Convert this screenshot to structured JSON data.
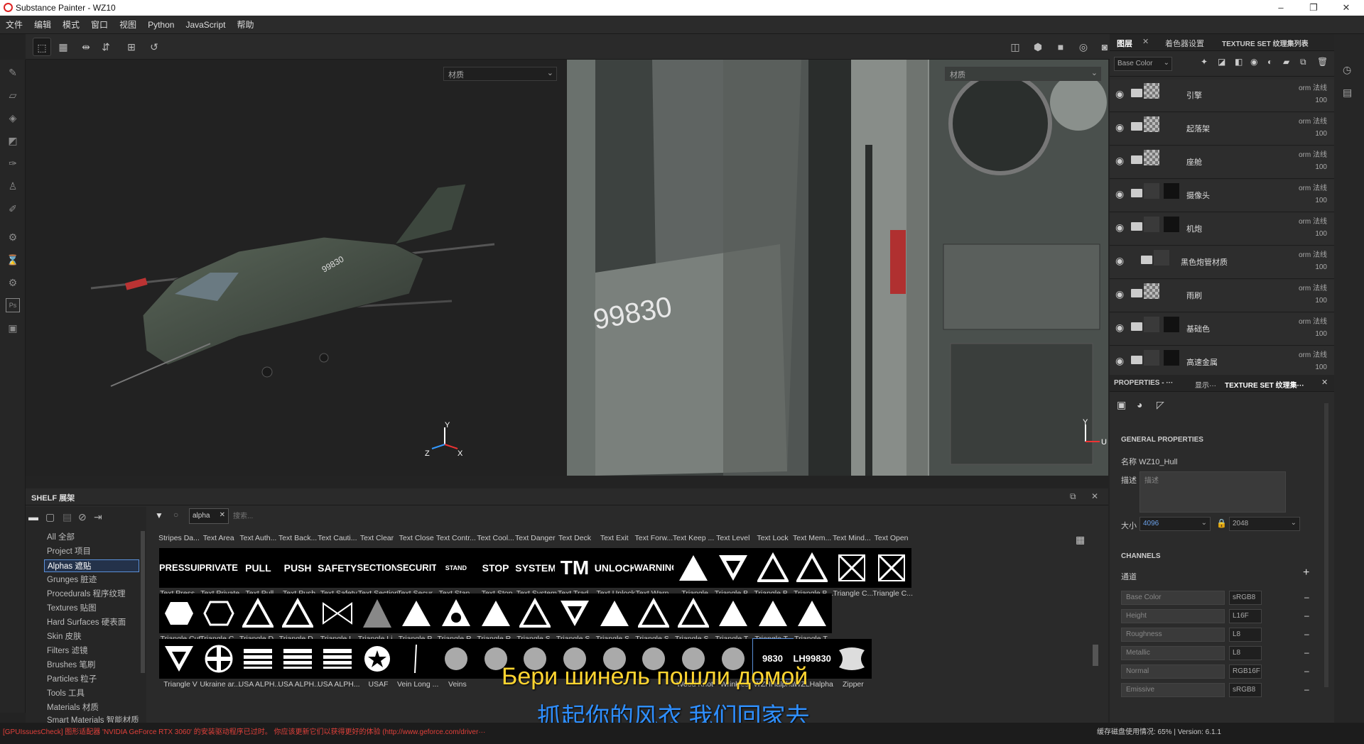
{
  "window": {
    "title": "Substance Painter - WZ10"
  },
  "menu": [
    "文件",
    "编辑",
    "模式",
    "窗口",
    "视图",
    "Python",
    "JavaScript",
    "帮助"
  ],
  "viewport": {
    "left_dropdown": "材质",
    "right_dropdown": "材质",
    "axes": {
      "x": "X",
      "y": "Y",
      "z": "Z",
      "u": "U"
    },
    "decal_text": "99830"
  },
  "layers_panel": {
    "tabs": [
      "图层",
      "着色器设置",
      "TEXTURE SET 纹理集列表"
    ],
    "channel_select": "Base Color",
    "layers": [
      {
        "name": "引擎",
        "blend": "orm 法线",
        "opacity": "100"
      },
      {
        "name": "起落架",
        "blend": "orm 法线",
        "opacity": "100"
      },
      {
        "name": "座舱",
        "blend": "orm 法线",
        "opacity": "100"
      },
      {
        "name": "摄像头",
        "blend": "orm 法线",
        "opacity": "100"
      },
      {
        "name": "机炮",
        "blend": "orm 法线",
        "opacity": "100"
      },
      {
        "name": "黑色炮管材质",
        "blend": "orm 法线",
        "opacity": "100"
      },
      {
        "name": "雨刷",
        "blend": "orm 法线",
        "opacity": "100"
      },
      {
        "name": "基础色",
        "blend": "orm 法线",
        "opacity": "100"
      },
      {
        "name": "高速金属",
        "blend": "orm 法线",
        "opacity": "100"
      }
    ]
  },
  "properties": {
    "tabs": [
      "PROPERTIES - ···",
      "显示···",
      "TEXTURE SET 纹理集···"
    ],
    "general_title": "GENERAL PROPERTIES",
    "name_label": "名称",
    "name_value": "WZ10_Hull",
    "desc_label": "描述",
    "desc_placeholder": "描述",
    "size_label": "大小",
    "size_value": "4096",
    "size_value2": "2048",
    "channels_title": "CHANNELS",
    "channels_label": "通道",
    "channels": [
      {
        "name": "Base Color",
        "format": "sRGB8"
      },
      {
        "name": "Height",
        "format": "L16F"
      },
      {
        "name": "Roughness",
        "format": "L8"
      },
      {
        "name": "Metallic",
        "format": "L8"
      },
      {
        "name": "Normal",
        "format": "RGB16F"
      },
      {
        "name": "Emissive",
        "format": "sRGB8"
      }
    ]
  },
  "shelf": {
    "title": "SHELF 展架",
    "categories": [
      "All 全部",
      "Project 项目",
      "Alphas 遮贴",
      "Grunges 脏迹",
      "Procedurals 程序纹理",
      "Textures 贴图",
      "Hard Surfaces 硬表面",
      "Skin 皮肤",
      "Filters 滤镜",
      "Brushes 笔刷",
      "Particles 粒子",
      "Tools 工具",
      "Materials 材质",
      "Smart Materials 智能材质"
    ],
    "selected_category": "Alphas 遮贴",
    "filter_tag": "alpha",
    "search_placeholder": "搜索...",
    "row0_labels": [
      "Stripes Da...",
      "Text Area",
      "Text Auth...",
      "Text Back...",
      "Text Cauti...",
      "Text Clear",
      "Text Close",
      "Text Contr...",
      "Text Cool...",
      "Text Danger",
      "Text Deck",
      "Text Exit",
      "Text Forw...",
      "Text Keep ...",
      "Text Level",
      "Text Lock",
      "Text Mem...",
      "Text Mind...",
      "Text Open"
    ],
    "row1": [
      {
        "img": "PRESSURE",
        "label": "Text Press..."
      },
      {
        "img": "PRIVATE",
        "label": "Text Private"
      },
      {
        "img": "PULL",
        "label": "Text Pull"
      },
      {
        "img": "PUSH",
        "label": "Text Push"
      },
      {
        "img": "SAFETY",
        "label": "Text Safety"
      },
      {
        "img": "SECTION",
        "label": "Text Section"
      },
      {
        "img": "SECURITY",
        "label": "Text Secur..."
      },
      {
        "img": "STAND CLEAR",
        "label": "Text Stan..."
      },
      {
        "img": "STOP",
        "label": "Text Stop"
      },
      {
        "img": "SYSTEM",
        "label": "Text System"
      },
      {
        "img": "TM",
        "label": "Text Trad..."
      },
      {
        "img": "UNLOCK",
        "label": "Text Unlock"
      },
      {
        "img": "WARNING",
        "label": "Text Warn..."
      },
      {
        "img": "",
        "label": "Triangle"
      },
      {
        "img": "",
        "label": "Triangle B..."
      },
      {
        "img": "",
        "label": "Triangle B..."
      },
      {
        "img": "",
        "label": "Triangle B..."
      },
      {
        "img": "",
        "label": "Triangle C..."
      },
      {
        "img": "",
        "label": "Triangle C..."
      }
    ],
    "row2_labels": [
      "Triangle Cut",
      "Triangle C...",
      "Triangle D...",
      "Triangle D...",
      "Triangle I...",
      "Triangle Li...",
      "Triangle P...",
      "Triangle R...",
      "Triangle R...",
      "Triangle S...",
      "Triangle S...",
      "Triangle S...",
      "Triangle S...",
      "Triangle S...",
      "Triangle T...",
      "Triangle T...",
      "Triangle T..."
    ],
    "row3": [
      {
        "img": "",
        "label": "Triangle V"
      },
      {
        "img": "",
        "label": "Ukraine ar..."
      },
      {
        "img": "",
        "label": "USA ALPH..."
      },
      {
        "img": "",
        "label": "USA ALPH..."
      },
      {
        "img": "",
        "label": "USA ALPH..."
      },
      {
        "img": "",
        "label": "USAF"
      },
      {
        "img": "",
        "label": "Vein Long ..."
      },
      {
        "img": "",
        "label": "Veins"
      },
      {
        "img": "",
        "label": ""
      },
      {
        "img": "",
        "label": ""
      },
      {
        "img": "",
        "label": ""
      },
      {
        "img": "",
        "label": ""
      },
      {
        "img": "",
        "label": ""
      },
      {
        "img": "",
        "label": "Wood Knot"
      },
      {
        "img": "",
        "label": "Wrinkles"
      },
      {
        "img": "9830",
        "label": "WZHHalpha"
      },
      {
        "img": "LH99830",
        "label": "WZLHalpha"
      },
      {
        "img": "",
        "label": "Zipper"
      }
    ]
  },
  "subtitles": {
    "ru": "Бери шинель пошли домой",
    "zh": "抓起你的风衣 我们回家去"
  },
  "status": {
    "warning": "[GPUIssuesCheck] 图形适配器 'NVIDIA GeForce RTX 3060' 的安装驱动程序已过时。 你应该更新它们以获得更好的体验 (http://www.geforce.com/driver···",
    "cache": "缓存磁盘使用情况: 65% | Version: 6.1.1"
  }
}
